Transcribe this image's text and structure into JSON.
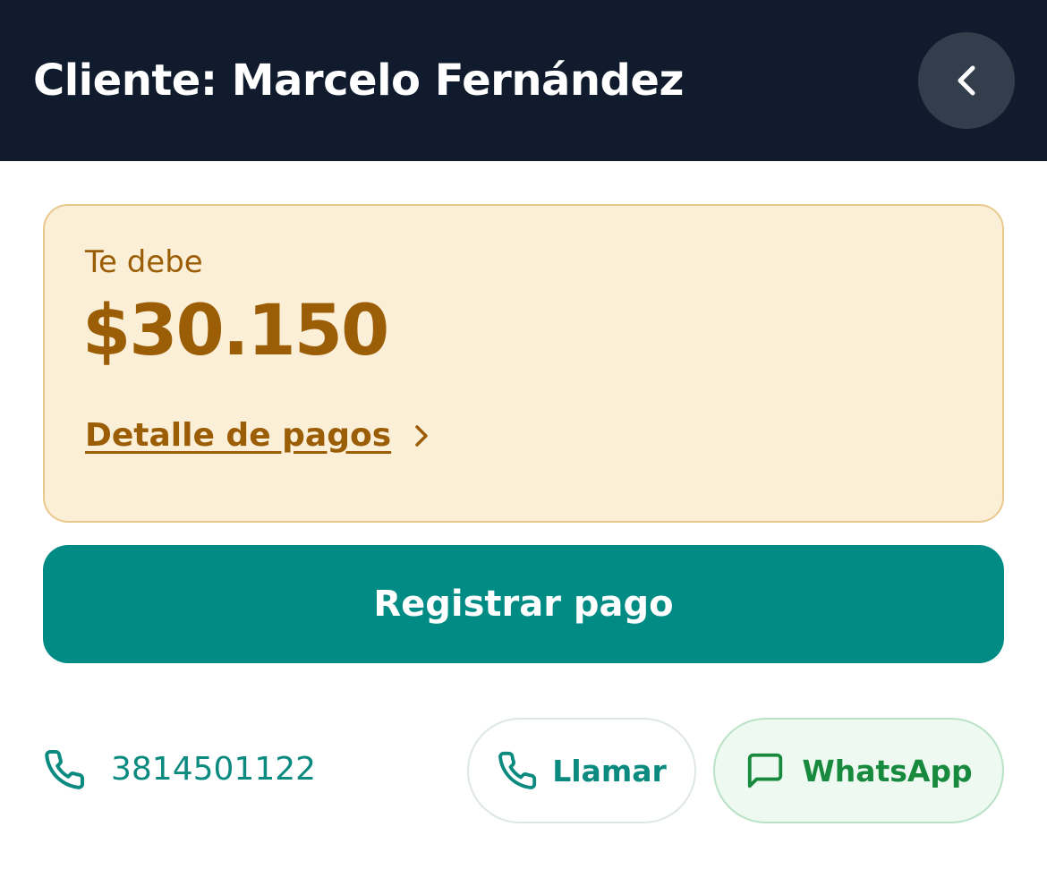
{
  "header": {
    "title": "Cliente: Marcelo Fernández",
    "back_icon": "chevron-left-icon"
  },
  "debt_card": {
    "label": "Te debe",
    "amount": "$30.150",
    "detail_link": "Detalle de pagos",
    "detail_icon": "chevron-right-icon"
  },
  "actions": {
    "register_payment": "Registrar pago"
  },
  "contact": {
    "phone_icon": "phone-icon",
    "phone_number": "3814501122",
    "call_label": "Llamar",
    "call_icon": "phone-icon",
    "whatsapp_label": "WhatsApp",
    "whatsapp_icon": "chat-bubble-icon"
  },
  "colors": {
    "header_bg": "#101c2e",
    "card_bg": "#fcefd8",
    "card_border": "#e9c88c",
    "amber_text": "#9b5e06",
    "primary": "#008c84",
    "whatsapp_green": "#188a3e"
  }
}
